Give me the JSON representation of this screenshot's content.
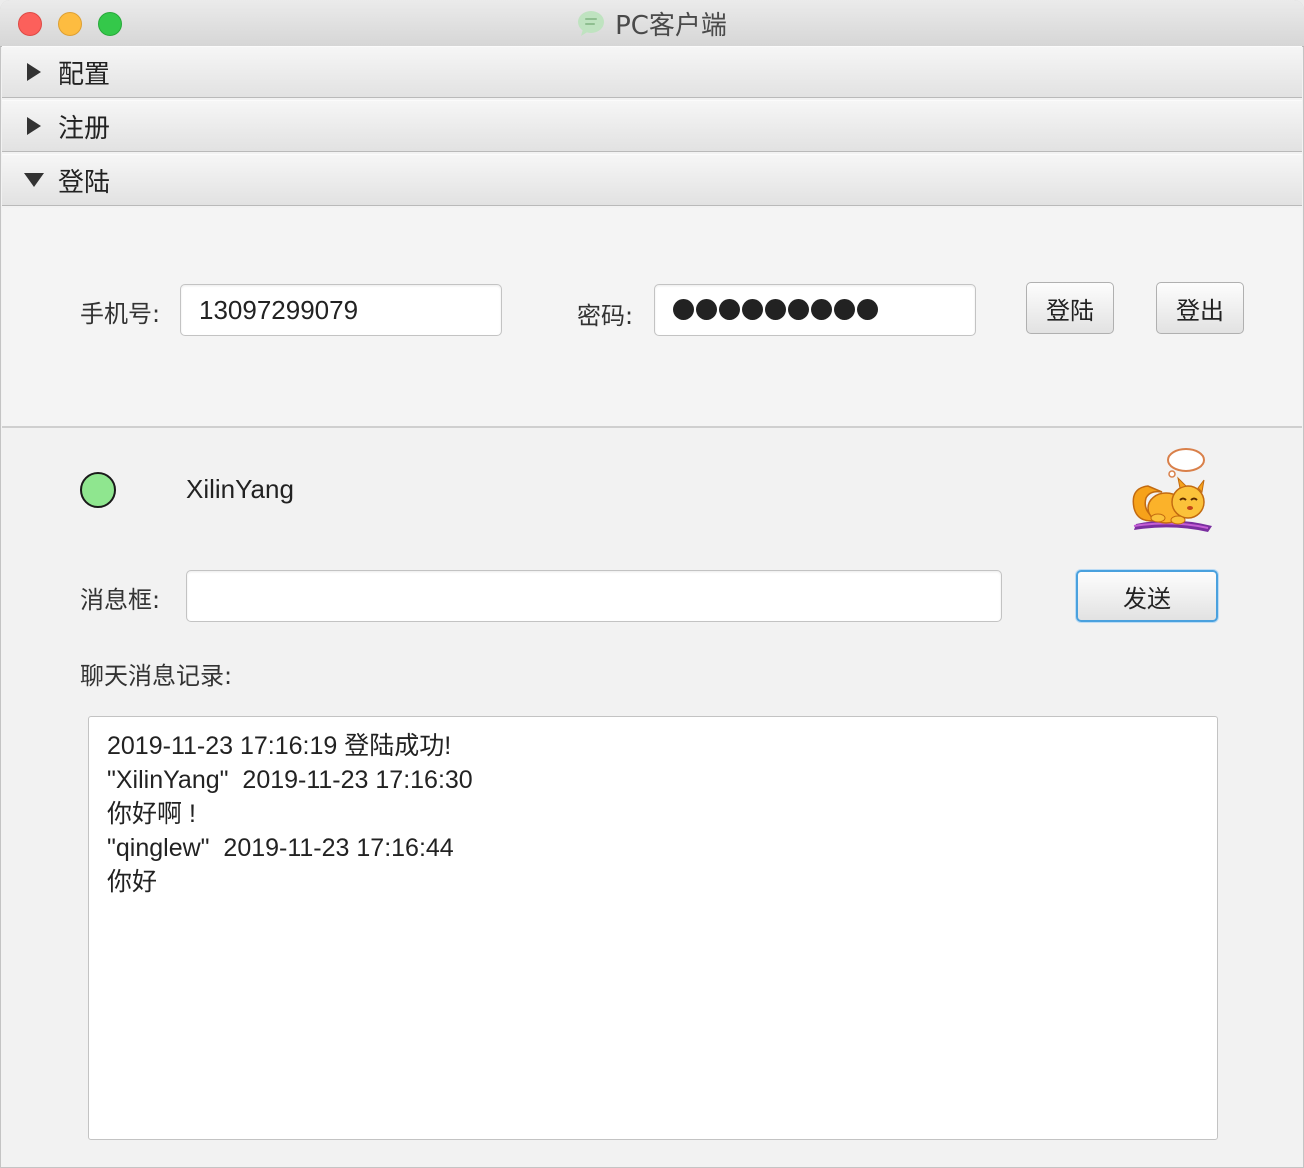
{
  "window": {
    "title": "PC客户端"
  },
  "panes": {
    "config": {
      "label": "配置",
      "expanded": false
    },
    "register": {
      "label": "注册",
      "expanded": false
    },
    "login": {
      "label": "登陆",
      "expanded": true
    }
  },
  "login": {
    "phone_label": "手机号:",
    "phone_value": "13097299079",
    "password_label": "密码:",
    "password_length": 9,
    "login_button": "登陆",
    "logout_button": "登出"
  },
  "chat": {
    "status_color": "#8fe68f",
    "user_name": "XilinYang",
    "message_label": "消息框:",
    "message_value": "",
    "send_button": "发送",
    "history_label": "聊天消息记录:",
    "history": [
      "2019-11-23 17:16:19 登陆成功!",
      "\"XilinYang\"  2019-11-23 17:16:30",
      "你好啊 !",
      "\"qinglew\"  2019-11-23 17:16:44",
      "你好"
    ]
  },
  "icons": {
    "app": "chat-bubble-icon",
    "mascot": "squirrel-mascot-icon",
    "collapsed": "triangle-right-icon",
    "expanded": "triangle-down-icon"
  }
}
